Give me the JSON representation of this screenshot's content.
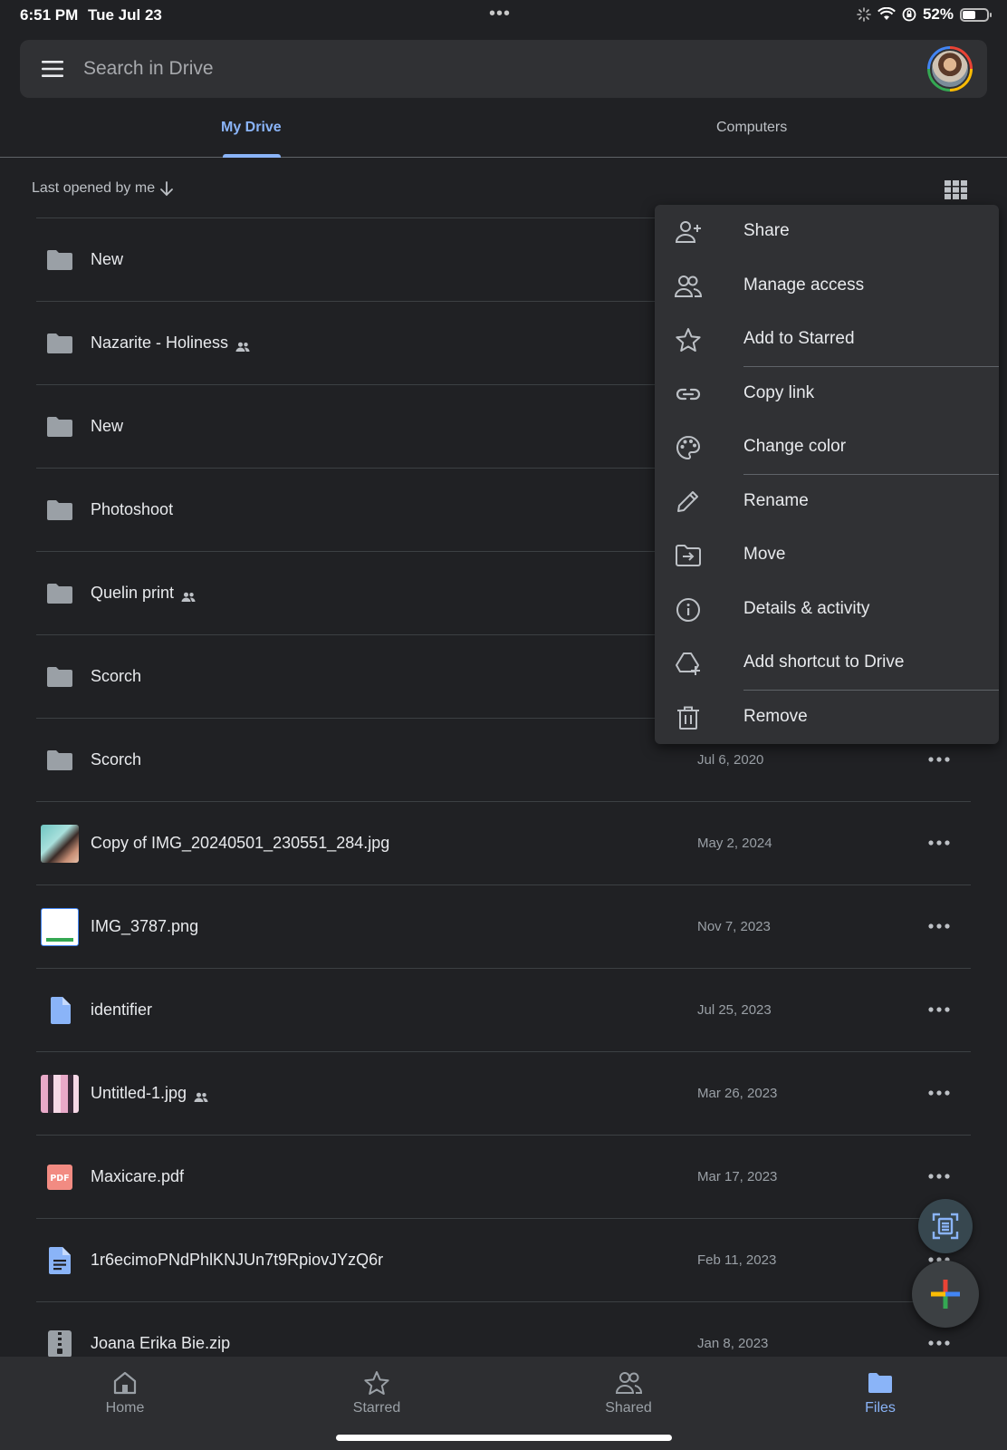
{
  "status_bar": {
    "time": "6:51 PM",
    "date": "Tue Jul 23",
    "multitask": "•••",
    "battery": "52%",
    "battery_level": 0.52
  },
  "search": {
    "placeholder": "Search in Drive"
  },
  "tabs": [
    {
      "label": "My Drive",
      "active": true
    },
    {
      "label": "Computers",
      "active": false
    }
  ],
  "sort": {
    "label": "Last opened by me",
    "direction": "descending"
  },
  "files": [
    {
      "name": "New",
      "type": "folder",
      "date": "",
      "shared": false,
      "icon": "folder-icon"
    },
    {
      "name": "Nazarite - Holiness",
      "type": "folder",
      "date": "",
      "shared": true,
      "icon": "folder-icon"
    },
    {
      "name": "New",
      "type": "folder",
      "date": "",
      "shared": false,
      "icon": "folder-icon"
    },
    {
      "name": "Photoshoot",
      "type": "folder",
      "date": "",
      "shared": false,
      "icon": "folder-icon"
    },
    {
      "name": "Quelin print",
      "type": "folder",
      "date": "",
      "shared": true,
      "icon": "folder-icon"
    },
    {
      "name": "Scorch",
      "type": "folder",
      "date": "",
      "shared": false,
      "icon": "folder-icon"
    },
    {
      "name": "Scorch",
      "type": "folder",
      "date": "Jul 6, 2020",
      "shared": false,
      "icon": "folder-icon"
    },
    {
      "name": "Copy of IMG_20240501_230551_284.jpg",
      "type": "image",
      "date": "May 2, 2024",
      "shared": false,
      "icon": "photo-thumbnail"
    },
    {
      "name": "IMG_3787.png",
      "type": "image",
      "date": "Nov 7, 2023",
      "shared": false,
      "icon": "screenshot-thumbnail"
    },
    {
      "name": "identifier",
      "type": "file",
      "date": "Jul 25, 2023",
      "shared": false,
      "icon": "blank-file-icon"
    },
    {
      "name": "Untitled-1.jpg",
      "type": "image",
      "date": "Mar 26, 2023",
      "shared": true,
      "icon": "collage-thumbnail"
    },
    {
      "name": "Maxicare.pdf",
      "type": "pdf",
      "date": "Mar 17, 2023",
      "shared": false,
      "icon": "pdf-icon"
    },
    {
      "name": "1r6ecimoPNdPhlKNJUn7t9RpiovJYzQ6r",
      "type": "doc",
      "date": "Feb 11, 2023",
      "shared": false,
      "icon": "docs-icon"
    },
    {
      "name": "Joana Erika Bie.zip",
      "type": "zip",
      "date": "Jan 8, 2023",
      "shared": false,
      "icon": "zip-icon"
    }
  ],
  "context_menu": {
    "items": [
      {
        "label": "Share",
        "icon": "add-person-icon"
      },
      {
        "label": "Manage access",
        "icon": "people-icon"
      },
      {
        "label": "Add to Starred",
        "icon": "star-icon"
      },
      {
        "label": "Copy link",
        "icon": "link-icon"
      },
      {
        "label": "Change color",
        "icon": "palette-icon"
      },
      {
        "label": "Rename",
        "icon": "pencil-icon"
      },
      {
        "label": "Move",
        "icon": "move-folder-icon"
      },
      {
        "label": "Details & activity",
        "icon": "info-icon"
      },
      {
        "label": "Add shortcut to Drive",
        "icon": "drive-shortcut-icon"
      },
      {
        "label": "Remove",
        "icon": "trash-icon"
      }
    ]
  },
  "bottom_nav": [
    {
      "label": "Home",
      "icon": "home-icon",
      "active": false
    },
    {
      "label": "Starred",
      "icon": "star-icon",
      "active": false
    },
    {
      "label": "Shared",
      "icon": "people-icon",
      "active": false
    },
    {
      "label": "Files",
      "icon": "folder-icon",
      "active": true
    }
  ],
  "colors": {
    "background": "#202124",
    "surface": "#303134",
    "accent": "#8ab4f8",
    "text": "#e8eaed",
    "muted": "#9aa0a6",
    "folder": "#9aa0a6"
  }
}
